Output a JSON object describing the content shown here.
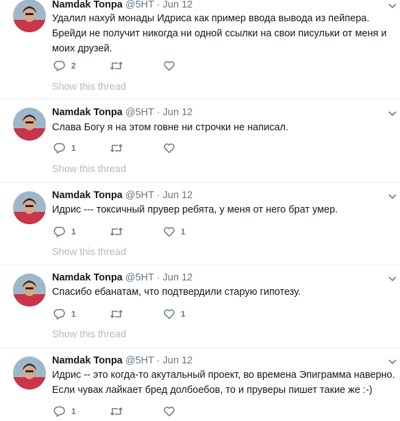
{
  "author": {
    "name": "Namdak Tonpa",
    "handle": "@5HT",
    "separator": "·"
  },
  "show_thread_label": "Show this thread",
  "tweets": [
    {
      "date": "Jun 12",
      "lines": [
        "Удалил нахуй монады Идриса как пример ввода вывода из пейпера.",
        "Брейди не получит никогда ни одной ссылки на свои писульки от меня и",
        "моих друзей."
      ],
      "replies": "2",
      "retweets": "",
      "likes": ""
    },
    {
      "date": "Jun 12",
      "lines": [
        "Слава Богу я на этом говне ни строчки не написал."
      ],
      "replies": "1",
      "retweets": "",
      "likes": ""
    },
    {
      "date": "Jun 12",
      "lines": [
        "Идрис --- токсичный прувер ребята, у меня от него брат умер."
      ],
      "replies": "1",
      "retweets": "",
      "likes": "1"
    },
    {
      "date": "Jun 12",
      "lines": [
        "Спасибо ебанатам, что подтвердили старую гипотезу."
      ],
      "replies": "1",
      "retweets": "",
      "likes": "1"
    },
    {
      "date": "Jun 12",
      "lines": [
        "Идрис -- это когда-то акутальный проект, во времена Эпиграмма наверно.",
        "Если чувак лайкает бред долбоебов, то и пруверы пишет такие же :-)"
      ],
      "replies": "1",
      "retweets": "",
      "likes": ""
    }
  ],
  "colors": {
    "text": "#14171a",
    "secondary": "#657786",
    "muted": "#b1bac1",
    "divider": "#e6ecf0"
  }
}
